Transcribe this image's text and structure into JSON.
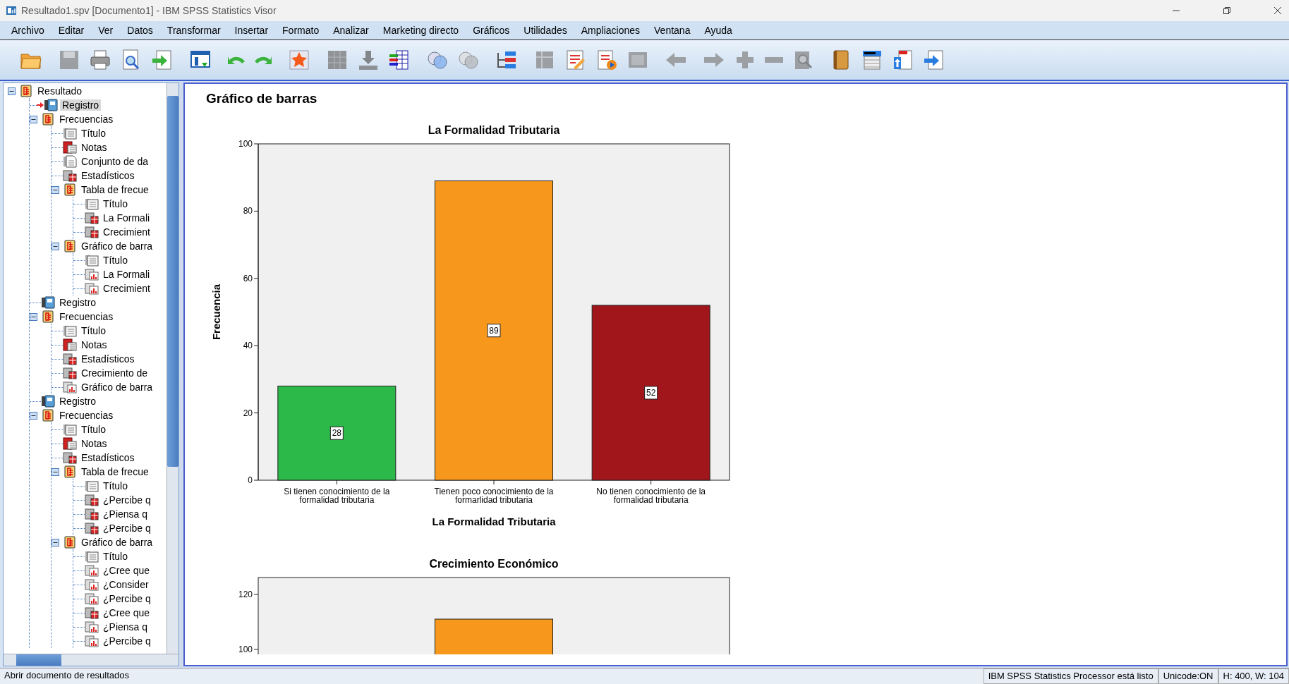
{
  "window": {
    "title": "Resultado1.spv [Documento1] - IBM SPSS Statistics Visor"
  },
  "menu": [
    "Archivo",
    "Editar",
    "Ver",
    "Datos",
    "Transformar",
    "Insertar",
    "Formato",
    "Analizar",
    "Marketing directo",
    "Gráficos",
    "Utilidades",
    "Ampliaciones",
    "Ventana",
    "Ayuda"
  ],
  "toolbar": [
    {
      "kind": "open",
      "disabled": false
    },
    {
      "kind": "save",
      "disabled": true
    },
    {
      "kind": "print",
      "disabled": false
    },
    {
      "kind": "preview",
      "disabled": false
    },
    {
      "kind": "export",
      "disabled": false
    },
    {
      "kind": "data",
      "disabled": false
    },
    {
      "kind": "undo",
      "disabled": false
    },
    {
      "kind": "redo",
      "disabled": false
    },
    {
      "kind": "star",
      "disabled": false
    },
    {
      "kind": "grid",
      "disabled": true
    },
    {
      "kind": "insert",
      "disabled": true
    },
    {
      "kind": "table",
      "disabled": false
    },
    {
      "kind": "circles",
      "disabled": false
    },
    {
      "kind": "circles",
      "disabled": true
    },
    {
      "kind": "list",
      "disabled": false
    },
    {
      "kind": "pivot",
      "disabled": true
    },
    {
      "kind": "edit",
      "disabled": false
    },
    {
      "kind": "script",
      "disabled": false
    },
    {
      "kind": "frame",
      "disabled": true
    },
    {
      "kind": "left",
      "disabled": true
    },
    {
      "kind": "right",
      "disabled": true
    },
    {
      "kind": "plus",
      "disabled": true
    },
    {
      "kind": "minus",
      "disabled": true
    },
    {
      "kind": "zoom",
      "disabled": true
    },
    {
      "kind": "book",
      "disabled": false
    },
    {
      "kind": "form",
      "disabled": false
    },
    {
      "kind": "docup",
      "disabled": false
    },
    {
      "kind": "docarrow",
      "disabled": false
    }
  ],
  "tree": [
    {
      "label": "Resultado",
      "kind": "output",
      "selected": false,
      "expanded": true,
      "children": [
        {
          "label": "Registro",
          "kind": "log",
          "selected": true
        },
        {
          "label": "Frecuencias",
          "kind": "output",
          "selected": false,
          "expanded": true,
          "children": [
            {
              "label": "Título",
              "kind": "title",
              "selected": false
            },
            {
              "label": "Notas",
              "kind": "notes",
              "selected": false
            },
            {
              "label": "Conjunto de da",
              "kind": "text",
              "selected": false
            },
            {
              "label": "Estadísticos",
              "kind": "table",
              "selected": false
            },
            {
              "label": "Tabla de frecue",
              "kind": "output",
              "selected": false,
              "expanded": true,
              "children": [
                {
                  "label": "Título",
                  "kind": "title",
                  "selected": false
                },
                {
                  "label": "La Formali",
                  "kind": "table",
                  "selected": false
                },
                {
                  "label": "Crecimient",
                  "kind": "table",
                  "selected": false
                }
              ]
            },
            {
              "label": "Gráfico de barra",
              "kind": "output",
              "selected": false,
              "expanded": true,
              "children": [
                {
                  "label": "Título",
                  "kind": "title",
                  "selected": false
                },
                {
                  "label": "La Formali",
                  "kind": "chart",
                  "selected": false
                },
                {
                  "label": "Crecimient",
                  "kind": "chart",
                  "selected": false
                }
              ]
            }
          ]
        },
        {
          "label": "Registro",
          "kind": "log",
          "selected": false
        },
        {
          "label": "Frecuencias",
          "kind": "output",
          "selected": false,
          "expanded": true,
          "children": [
            {
              "label": "Título",
              "kind": "title",
              "selected": false
            },
            {
              "label": "Notas",
              "kind": "notes",
              "selected": false
            },
            {
              "label": "Estadísticos",
              "kind": "table",
              "selected": false
            },
            {
              "label": "Crecimiento de",
              "kind": "table",
              "selected": false
            },
            {
              "label": "Gráfico de barra",
              "kind": "chart",
              "selected": false
            }
          ]
        },
        {
          "label": "Registro",
          "kind": "log",
          "selected": false
        },
        {
          "label": "Frecuencias",
          "kind": "output",
          "selected": false,
          "expanded": true,
          "children": [
            {
              "label": "Título",
              "kind": "title",
              "selected": false
            },
            {
              "label": "Notas",
              "kind": "notes",
              "selected": false
            },
            {
              "label": "Estadísticos",
              "kind": "table",
              "selected": false
            },
            {
              "label": "Tabla de frecue",
              "kind": "output",
              "selected": false,
              "expanded": true,
              "children": [
                {
                  "label": "Título",
                  "kind": "title",
                  "selected": false
                },
                {
                  "label": "¿Percibe q",
                  "kind": "table",
                  "selected": false
                },
                {
                  "label": "¿Piensa q",
                  "kind": "table",
                  "selected": false
                },
                {
                  "label": "¿Percibe q",
                  "kind": "table",
                  "selected": false
                }
              ]
            },
            {
              "label": "Gráfico de barra",
              "kind": "output",
              "selected": false,
              "expanded": true,
              "children": [
                {
                  "label": "Título",
                  "kind": "title",
                  "selected": false
                },
                {
                  "label": "¿Cree que",
                  "kind": "chart",
                  "selected": false
                },
                {
                  "label": "¿Consider",
                  "kind": "chart",
                  "selected": false
                },
                {
                  "label": "¿Percibe q",
                  "kind": "chart",
                  "selected": false
                },
                {
                  "label": "¿Cree que",
                  "kind": "table",
                  "selected": false
                },
                {
                  "label": "¿Piensa q",
                  "kind": "chart",
                  "selected": false
                },
                {
                  "label": "¿Percibe q",
                  "kind": "chart",
                  "selected": false
                }
              ]
            }
          ]
        }
      ]
    }
  ],
  "output": {
    "heading": "Gráfico de barras",
    "chart": {
      "chart_data": {
        "type": "bar",
        "title": "La Formalidad Tributaria",
        "xlabel": "La Formalidad Tributaria",
        "ylabel": "Frecuencia",
        "categories": [
          "Si tienen conocimiento de la formalidad tributaria",
          "Tienen poco conocimiento de la formarlidad tributaria",
          "No tienen conocimiento de la formalidad tributaria"
        ],
        "series": [
          {
            "values": [
              28,
              89,
              52
            ]
          }
        ],
        "colors": [
          "#2db84a",
          "#f7981d",
          "#a0161a"
        ],
        "ylim": [
          0,
          100
        ],
        "yticks": [
          0,
          20,
          40,
          60,
          80,
          100
        ],
        "data_labels": true
      }
    },
    "chart2": {
      "title": "Crecimiento Económico",
      "ytick_labels": [
        "120",
        "100"
      ]
    }
  },
  "status_bar": [
    "Abrir documento de resultados",
    "IBM SPSS Statistics Processor está listo",
    "Unicode:ON",
    "H: 400, W: 104"
  ]
}
